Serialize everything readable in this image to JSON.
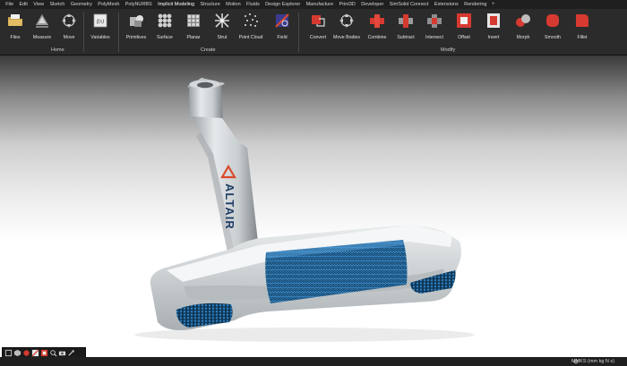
{
  "menu": {
    "items": [
      "File",
      "Edit",
      "View",
      "Sketch",
      "Geometry",
      "PolyMesh",
      "PolyNURBS",
      "Implicit Modeling",
      "Structure",
      "Motion",
      "Fluids",
      "Design Explorer",
      "Manufacture",
      "Print3D",
      "Developer",
      "SimSolid Connect",
      "Extensions",
      "Rendering"
    ],
    "active_index": 7,
    "add_tab": "+"
  },
  "ribbon": {
    "groups": {
      "home": "Home",
      "create": "Create",
      "modify": "Modify"
    },
    "tools": {
      "files": "Files",
      "measure": "Measure",
      "move": "Move",
      "variables": "Variables",
      "variables_glyph": "f(x)",
      "primitives": "Primitives",
      "surface": "Surface",
      "planar": "Planar",
      "strut": "Strut",
      "point_cloud": "Point Cloud",
      "field": "Field",
      "convert": "Convert",
      "move_bodies": "Move Bodies",
      "combine": "Combine",
      "subtract": "Subtract",
      "intersect": "Intersect",
      "offset": "Offset",
      "invert": "Invert",
      "morph": "Morph",
      "smooth": "Smooth",
      "fillet": "Fillet"
    }
  },
  "model": {
    "brand": "ALTAIR",
    "lattice_color": "#1f6fa8",
    "logo_color": "#d94a2a"
  },
  "status": {
    "units": "MMKS (mm kg N s)"
  },
  "colors": {
    "accent_red": "#e23a2e",
    "menubar": "#1f1f1f",
    "ribbon": "#2b2b2b"
  }
}
